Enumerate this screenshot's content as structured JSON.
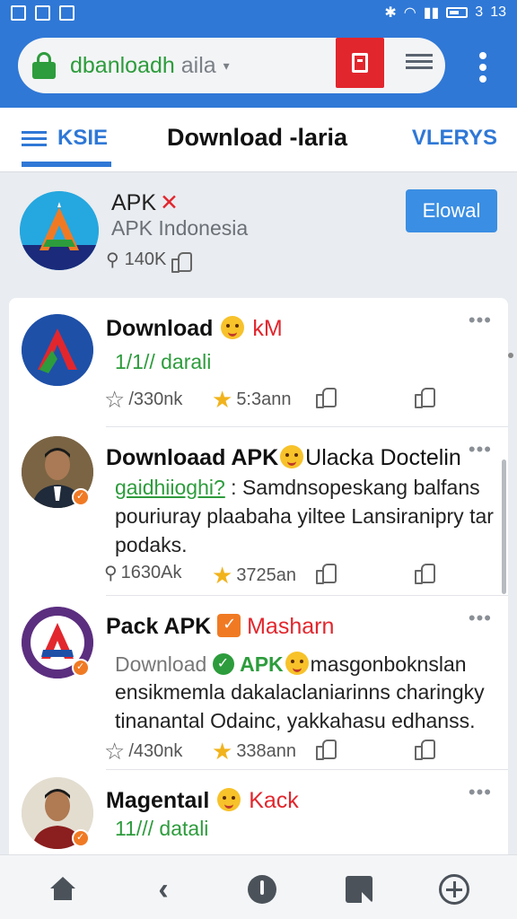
{
  "status_bar": {
    "time": "13",
    "battery": "3"
  },
  "url_bar": {
    "text_green": "dbanloadh",
    "text_grey": "aila"
  },
  "tabs": {
    "left_label": "KSIE",
    "title": "Download -laria",
    "right_label": "VLERYS"
  },
  "app": {
    "name": "APK",
    "subtitle": "APK Indonesia",
    "stats": "140K",
    "button_label": "Elowal"
  },
  "posts": [
    {
      "title": "Download",
      "title_tag": "kM",
      "date": "1/1// darali",
      "stat1": "/330nk",
      "stat2": "5:3ann"
    },
    {
      "title": "Downloaad APK",
      "title_rest": "Ulacka Doctelin",
      "line1_link": "gaidhiioghi?",
      "line1_rest": ": Samdnsopeskang balfans",
      "line2": "pouriuray plaabaha yiltee Lansiranipry tar",
      "line3": "podaks.",
      "stat1": "1630Ak",
      "stat2": "3725an"
    },
    {
      "title": "Pack APK",
      "title_tag": "Masharn",
      "line1_a": "Download",
      "line1_apk": "APK",
      "line1_rest": "masgonboknslan",
      "line2": "ensikmemla dakalaclaniarinns charingky",
      "line3": "tinanantal Odainc, yakkahasu edhanss.",
      "stat1": "/430nk",
      "stat2": "338ann"
    },
    {
      "title": "Magentaıl",
      "title_tag": "Kack",
      "date": "11/// datali"
    }
  ],
  "colors": {
    "primary": "#2f78d6",
    "green": "#2d9c3c",
    "red": "#e2262d",
    "gold": "#f1b31c"
  }
}
